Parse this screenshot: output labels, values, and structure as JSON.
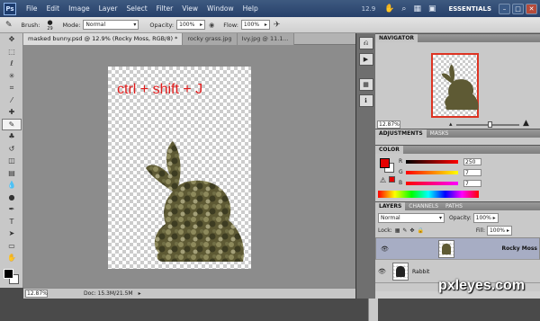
{
  "menubar": {
    "logo": "Ps",
    "items": [
      "File",
      "Edit",
      "Image",
      "Layer",
      "Select",
      "Filter",
      "View",
      "Window",
      "Help"
    ],
    "zoom": "12.9",
    "workspace": "ESSENTIALS"
  },
  "options": {
    "brush_label": "Brush:",
    "brush_size": "29",
    "mode_label": "Mode:",
    "mode_value": "Normal",
    "opacity_label": "Opacity:",
    "opacity_value": "100%",
    "flow_label": "Flow:",
    "flow_value": "100%"
  },
  "tabs": [
    {
      "label": "masked bunny.psd @ 12.9% (Rocky Moss, RGB/8) *"
    },
    {
      "label": "rocky grass.jpg"
    },
    {
      "label": "Ivy.jpg @ 11.1..."
    }
  ],
  "canvas": {
    "shortcut_text": "ctrl + shift + J"
  },
  "status": {
    "zoom": "12.87%",
    "doc": "Doc: 15.3M/21.5M"
  },
  "navigator": {
    "title": "NAVIGATOR",
    "zoom": "12.87%"
  },
  "adjustments": {
    "tabs": [
      "ADJUSTMENTS",
      "MASKS"
    ]
  },
  "color": {
    "title": "COLOR",
    "channels": [
      {
        "name": "R",
        "value": "250",
        "gradient": "linear-gradient(to right,#000,#f00)"
      },
      {
        "name": "G",
        "value": "7",
        "gradient": "linear-gradient(to right,#f00,#ff0)"
      },
      {
        "name": "B",
        "value": "7",
        "gradient": "linear-gradient(to right,#f00,#f0f)"
      }
    ]
  },
  "layers": {
    "tabs": [
      "LAYERS",
      "CHANNELS",
      "PATHS"
    ],
    "blend_mode": "Normal",
    "opacity_label": "Opacity:",
    "opacity_value": "100%",
    "lock_label": "Lock:",
    "fill_label": "Fill:",
    "fill_value": "100%",
    "items": [
      {
        "name": "Rocky Moss",
        "selected": true
      },
      {
        "name": "Rabbit",
        "selected": false
      }
    ]
  },
  "watermark": "pxleyes.com"
}
